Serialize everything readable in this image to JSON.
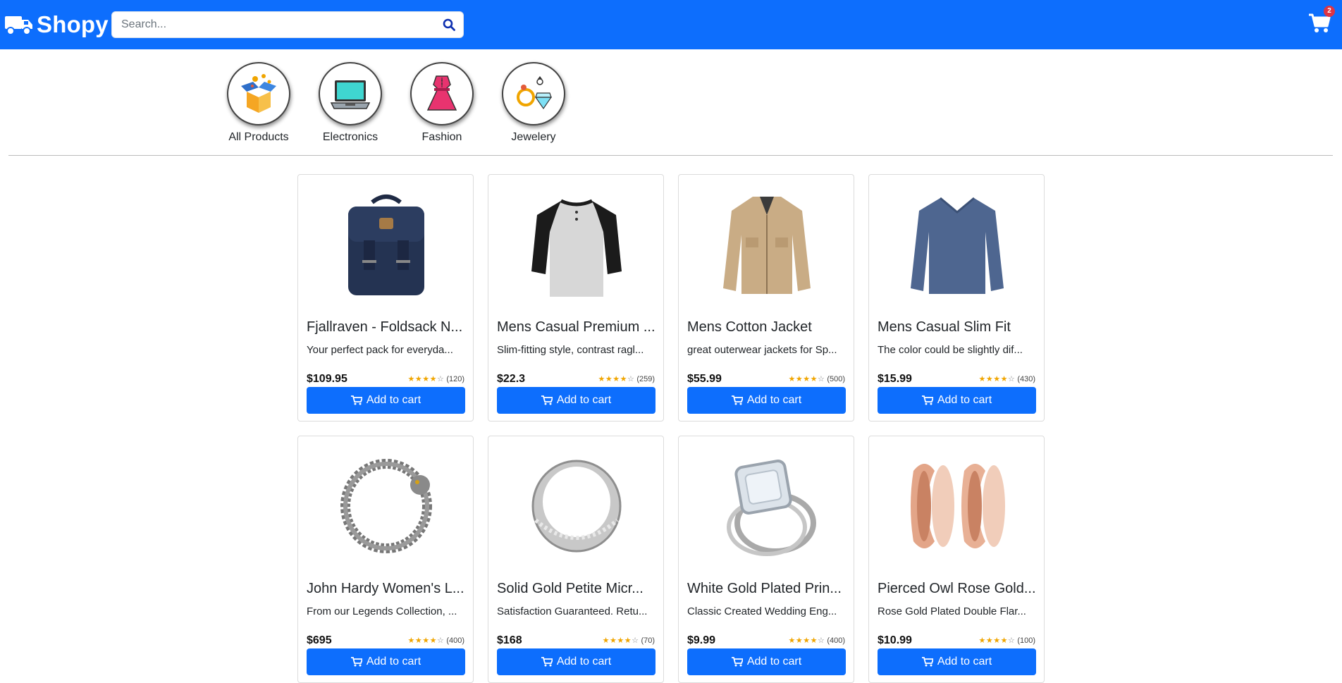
{
  "brand": {
    "name": "Shopy"
  },
  "search": {
    "placeholder": "Search..."
  },
  "cart": {
    "count": "2"
  },
  "categories": [
    {
      "label": "All Products",
      "icon": "open-box-icon"
    },
    {
      "label": "Electronics",
      "icon": "laptop-icon"
    },
    {
      "label": "Fashion",
      "icon": "dress-icon"
    },
    {
      "label": "Jewelery",
      "icon": "diamond-ring-icon"
    }
  ],
  "products": [
    {
      "title": "Fjallraven - Foldsack N...",
      "desc": "Your perfect pack for everyda...",
      "price": "$109.95",
      "count": "(120)",
      "stars": 4,
      "image": "backpack-image"
    },
    {
      "title": "Mens Casual Premium ...",
      "desc": "Slim-fitting style, contrast ragl...",
      "price": "$22.3",
      "count": "(259)",
      "stars": 4,
      "image": "raglan-tshirt-image"
    },
    {
      "title": "Mens Cotton Jacket",
      "desc": "great outerwear jackets for Sp...",
      "price": "$55.99",
      "count": "(500)",
      "stars": 4,
      "image": "cotton-jacket-image"
    },
    {
      "title": "Mens Casual Slim Fit",
      "desc": "The color could be slightly dif...",
      "price": "$15.99",
      "count": "(430)",
      "stars": 4,
      "image": "slim-fit-shirt-image"
    },
    {
      "title": "John Hardy Women's L...",
      "desc": "From our Legends Collection, ...",
      "price": "$695",
      "count": "(400)",
      "stars": 4,
      "image": "dragon-bracelet-image"
    },
    {
      "title": "Solid Gold Petite Micr...",
      "desc": "Satisfaction Guaranteed. Retu...",
      "price": "$168",
      "count": "(70)",
      "stars": 4,
      "image": "silver-band-ring-image"
    },
    {
      "title": "White Gold Plated Prin...",
      "desc": "Classic Created Wedding Eng...",
      "price": "$9.99",
      "count": "(400)",
      "stars": 4,
      "image": "engagement-ring-image"
    },
    {
      "title": "Pierced Owl Rose Gold...",
      "desc": "Rose Gold Plated Double Flar...",
      "price": "$10.99",
      "count": "(100)",
      "stars": 4,
      "image": "tunnel-plugs-image"
    }
  ],
  "add_to_cart_label": "Add to cart",
  "colors": {
    "primary": "#0d6efd",
    "badge": "#dc3545",
    "star": "#f0a500"
  }
}
